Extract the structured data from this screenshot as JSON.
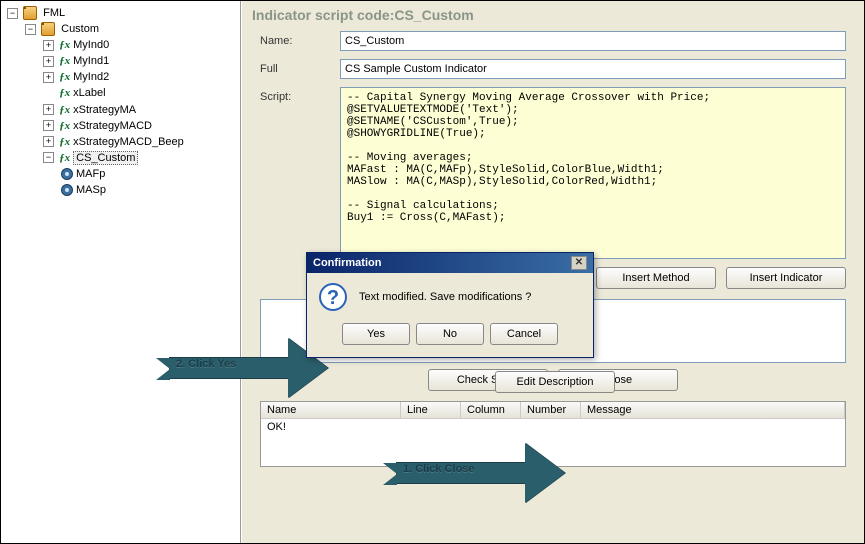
{
  "header": {
    "title": "Indicator script code:CS_Custom"
  },
  "tree": {
    "root": "FML",
    "custom": "Custom",
    "items": [
      "MyInd0",
      "MyInd1",
      "MyInd2",
      "xLabel",
      "xStrategyMA",
      "xStrategyMACD",
      "xStrategyMACD_Beep"
    ],
    "selected": "CS_Custom",
    "children": [
      "MAFp",
      "MASp"
    ]
  },
  "form": {
    "name_label": "Name:",
    "name_value": "CS_Custom",
    "full_label": "Full",
    "full_value": "CS Sample Custom Indicator",
    "script_label": "Script:",
    "script_text": "-- Capital Synergy Moving Average Crossover with Price;\n@SETVALUETEXTMODE('Text');\n@SETNAME('CSCustom',True);\n@SHOWYGRIDLINE(True);\n\n-- Moving averages;\nMAFast : MA(C,MAFp),StyleSolid,ColorBlue,Width1;\nMASlow : MA(C,MASp),StyleSolid,ColorRed,Width1;\n\n-- Signal calculations;\nBuy1 := Cross(C,MAFast);"
  },
  "buttons": {
    "insert_method": "Insert Method",
    "insert_indicator": "Insert Indicator",
    "edit_description": "Edit Description",
    "check_script": "Check Script",
    "close": "Close"
  },
  "dialog": {
    "title": "Confirmation",
    "message": "Text modified. Save modifications ?",
    "yes": "Yes",
    "no": "No",
    "cancel": "Cancel"
  },
  "annotations": {
    "step1": "1. Click Close",
    "step2": "2. Click Yes"
  },
  "grid": {
    "cols": [
      "Name",
      "Line",
      "Column",
      "Number",
      "Message"
    ],
    "row0": "OK!"
  }
}
